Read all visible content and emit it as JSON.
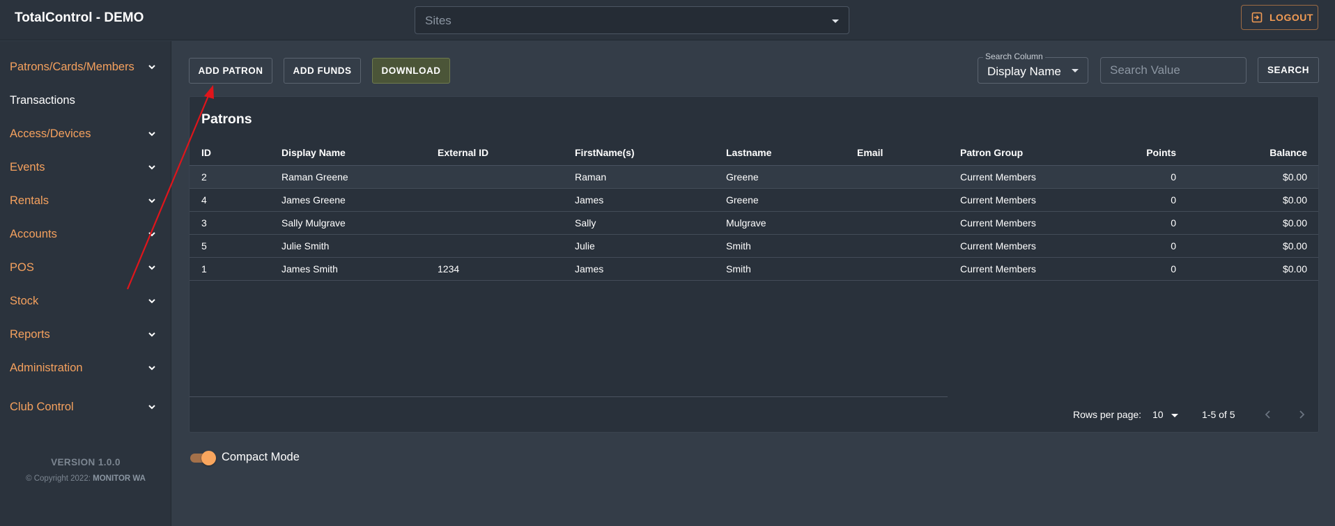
{
  "app": {
    "title": "TotalControl - DEMO"
  },
  "header": {
    "sites_placeholder": "Sites",
    "logout_label": "LOGOUT"
  },
  "sidebar": {
    "items": [
      {
        "label": "Patrons/Cards/Members",
        "expandable": true
      },
      {
        "label": "Transactions",
        "expandable": false
      },
      {
        "label": "Access/Devices",
        "expandable": true
      },
      {
        "label": "Events",
        "expandable": true
      },
      {
        "label": "Rentals",
        "expandable": true
      },
      {
        "label": "Accounts",
        "expandable": true
      },
      {
        "label": "POS",
        "expandable": true
      },
      {
        "label": "Stock",
        "expandable": true
      },
      {
        "label": "Reports",
        "expandable": true
      },
      {
        "label": "Administration",
        "expandable": true
      },
      {
        "label": "Club Control",
        "expandable": true
      }
    ],
    "version": "VERSION 1.0.0",
    "copyright_prefix": "© Copyright 2022:",
    "copyright_owner": "MONITOR WA"
  },
  "toolbar": {
    "add_patron": "ADD PATRON",
    "add_funds": "ADD FUNDS",
    "download": "DOWNLOAD",
    "search_column_label": "Search Column",
    "search_column_value": "Display Name",
    "search_value_placeholder": "Search Value",
    "search": "SEARCH"
  },
  "table": {
    "title": "Patrons",
    "columns": [
      "ID",
      "Display Name",
      "External ID",
      "FirstName(s)",
      "Lastname",
      "Email",
      "Patron Group",
      "Points",
      "Balance"
    ],
    "rows": [
      [
        "2",
        "Raman Greene",
        "",
        "Raman",
        "Greene",
        "",
        "Current Members",
        "0",
        "$0.00"
      ],
      [
        "4",
        "James Greene",
        "",
        "James",
        "Greene",
        "",
        "Current Members",
        "0",
        "$0.00"
      ],
      [
        "3",
        "Sally Mulgrave",
        "",
        "Sally",
        "Mulgrave",
        "",
        "Current Members",
        "0",
        "$0.00"
      ],
      [
        "5",
        "Julie Smith",
        "",
        "Julie",
        "Smith",
        "",
        "Current Members",
        "0",
        "$0.00"
      ],
      [
        "1",
        "James Smith",
        "1234",
        "James",
        "Smith",
        "",
        "Current Members",
        "0",
        "$0.00"
      ]
    ],
    "pagination": {
      "rows_per_page_label": "Rows per page:",
      "rows_per_page": "10",
      "range": "1-5 of 5"
    }
  },
  "footer": {
    "compact_mode_label": "Compact Mode",
    "compact_mode_on": true
  },
  "colors": {
    "accent": "#f5a15e",
    "background": "#343d48",
    "sidebar": "#2b333d",
    "card": "#29313b",
    "annotation_arrow": "#e0151b"
  },
  "icons": {
    "logout": "logout-icon",
    "chevron": "chevron-down-icon",
    "prev": "chevron-left-icon",
    "next": "chevron-right-icon"
  }
}
